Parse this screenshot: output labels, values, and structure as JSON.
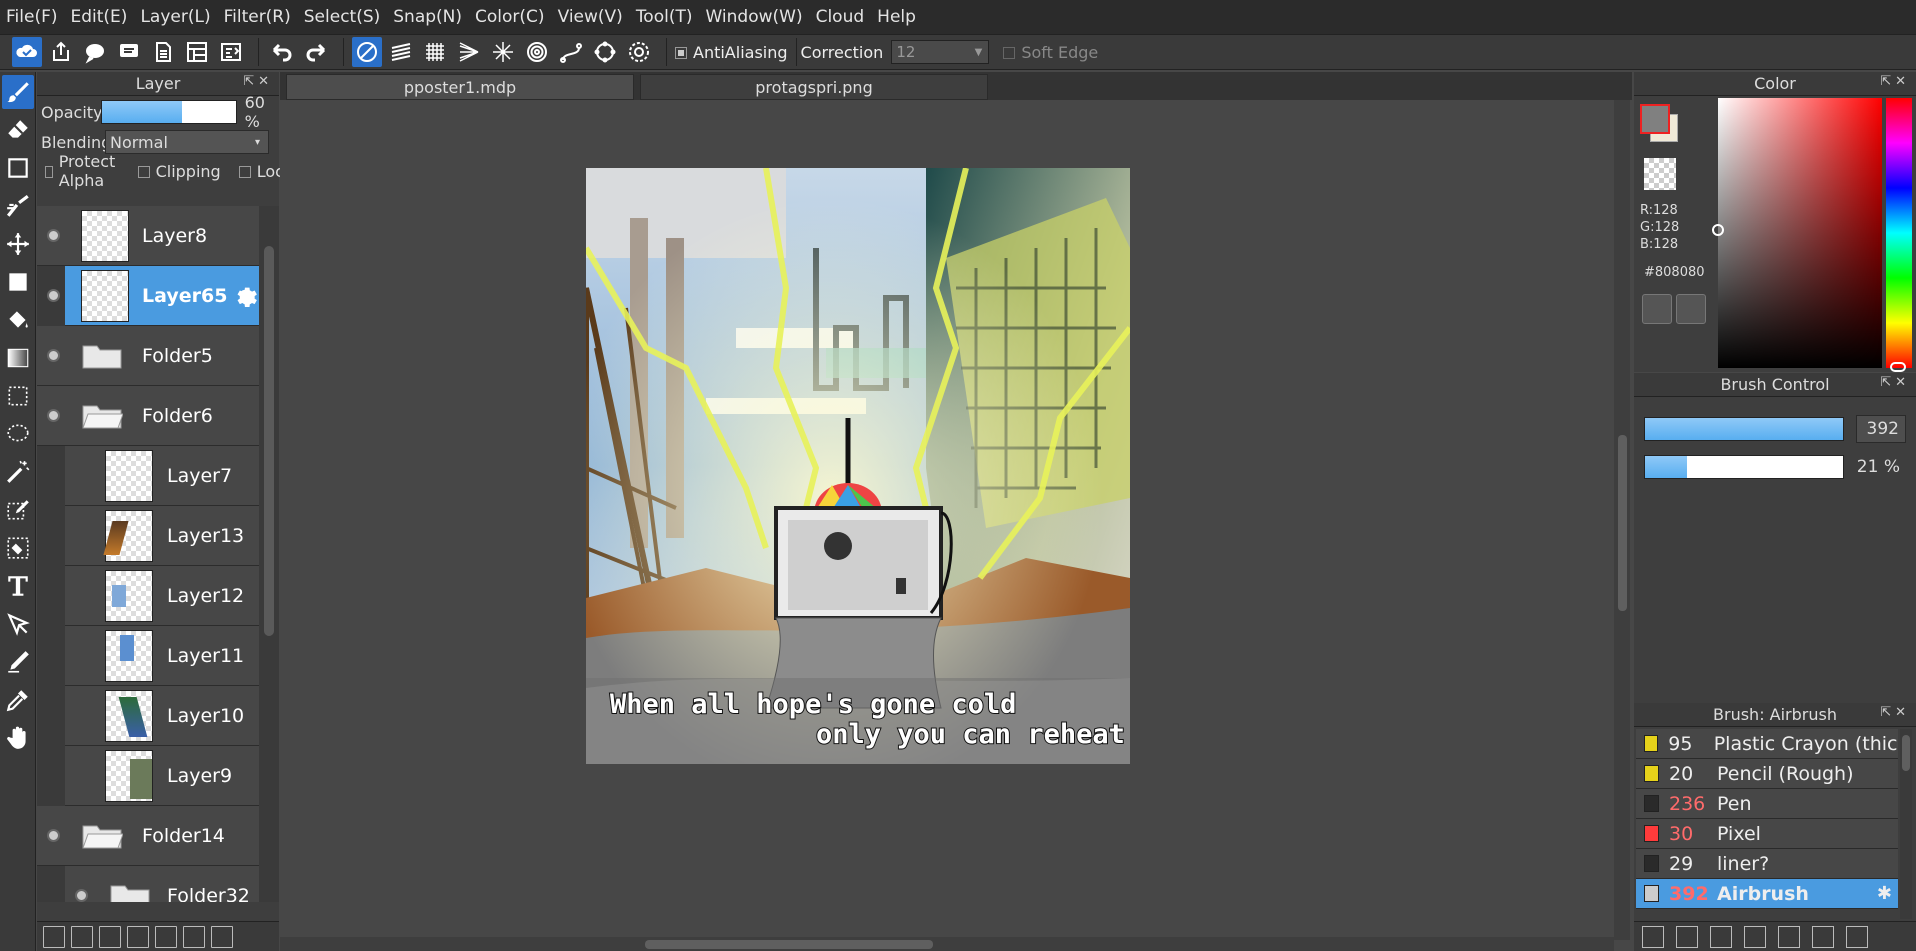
{
  "menu": [
    "File(F)",
    "Edit(E)",
    "Layer(L)",
    "Filter(R)",
    "Select(S)",
    "Snap(N)",
    "Color(C)",
    "View(V)",
    "Tool(T)",
    "Window(W)",
    "Cloud",
    "Help"
  ],
  "toolbar": {
    "antialiasing_label": "AntiAliasing",
    "correction_label": "Correction",
    "correction_value": "12",
    "soft_edge_label": "Soft Edge"
  },
  "layer_panel": {
    "title": "Layer",
    "opacity_label": "Opacity",
    "opacity_value": "60 %",
    "opacity_fraction": 0.6,
    "blending_label": "Blending",
    "blending_value": "Normal",
    "protect_alpha": "Protect Alpha",
    "clipping": "Clipping",
    "lock": "Lock",
    "layers": [
      {
        "name": "Layer8",
        "kind": "layer"
      },
      {
        "name": "Layer65",
        "kind": "layer",
        "selected": true
      },
      {
        "name": "Folder5",
        "kind": "folder"
      },
      {
        "name": "Folder6",
        "kind": "folder"
      },
      {
        "name": "Layer7",
        "kind": "layer",
        "child": true
      },
      {
        "name": "Layer13",
        "kind": "layer",
        "child": true
      },
      {
        "name": "Layer12",
        "kind": "layer",
        "child": true
      },
      {
        "name": "Layer11",
        "kind": "layer",
        "child": true
      },
      {
        "name": "Layer10",
        "kind": "layer",
        "child": true
      },
      {
        "name": "Layer9",
        "kind": "layer",
        "child": true
      },
      {
        "name": "Folder14",
        "kind": "folder"
      },
      {
        "name": "Folder32",
        "kind": "folder",
        "child": true
      }
    ]
  },
  "tabs": [
    "pposter1.mdp",
    "protagspri.png"
  ],
  "artwork": {
    "caption_line1": "When all hope's gone cold",
    "caption_line2": "only you can reheat it"
  },
  "color_panel": {
    "title": "Color",
    "r": "R:128",
    "g": "G:128",
    "b": "B:128",
    "hex": "#808080"
  },
  "brush_control": {
    "title": "Brush Control",
    "size_value": "392",
    "size_fraction": 1.0,
    "opacity_value": "21 %",
    "opacity_fraction": 0.21
  },
  "brush_list": {
    "title": "Brush: Airbrush",
    "items": [
      {
        "size": "95",
        "name": "Plastic Crayon (thick",
        "color": "#e6d21a"
      },
      {
        "size": "20",
        "name": "Pencil (Rough)",
        "color": "#e6d21a"
      },
      {
        "size": "236",
        "name": "Pen",
        "color": "#2a2a2a",
        "size_color": "#ff6b6b"
      },
      {
        "size": "30",
        "name": "Pixel",
        "color": "#ff3b3b",
        "size_color": "#ff6b6b"
      },
      {
        "size": "29",
        "name": "liner?",
        "color": "#2a2a2a"
      },
      {
        "size": "392",
        "name": "Airbrush",
        "color": "#cccccc",
        "selected": true,
        "size_color": "#ff6b6b"
      }
    ]
  }
}
